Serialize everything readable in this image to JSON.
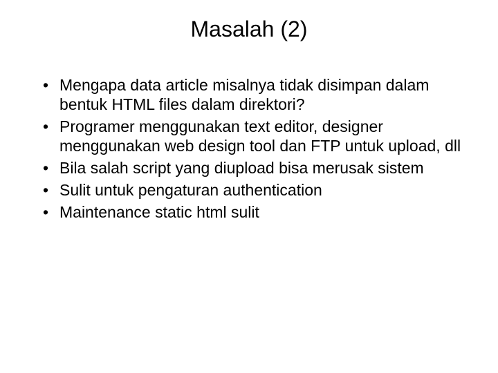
{
  "slide": {
    "title": "Masalah (2)",
    "bullets": [
      "Mengapa data article misalnya tidak disimpan dalam bentuk HTML files dalam direktori?",
      "Programer menggunakan text editor, designer menggunakan web design tool dan FTP untuk upload, dll",
      "Bila salah script yang diupload bisa merusak sistem",
      "Sulit untuk pengaturan authentication",
      "Maintenance static html sulit"
    ]
  }
}
